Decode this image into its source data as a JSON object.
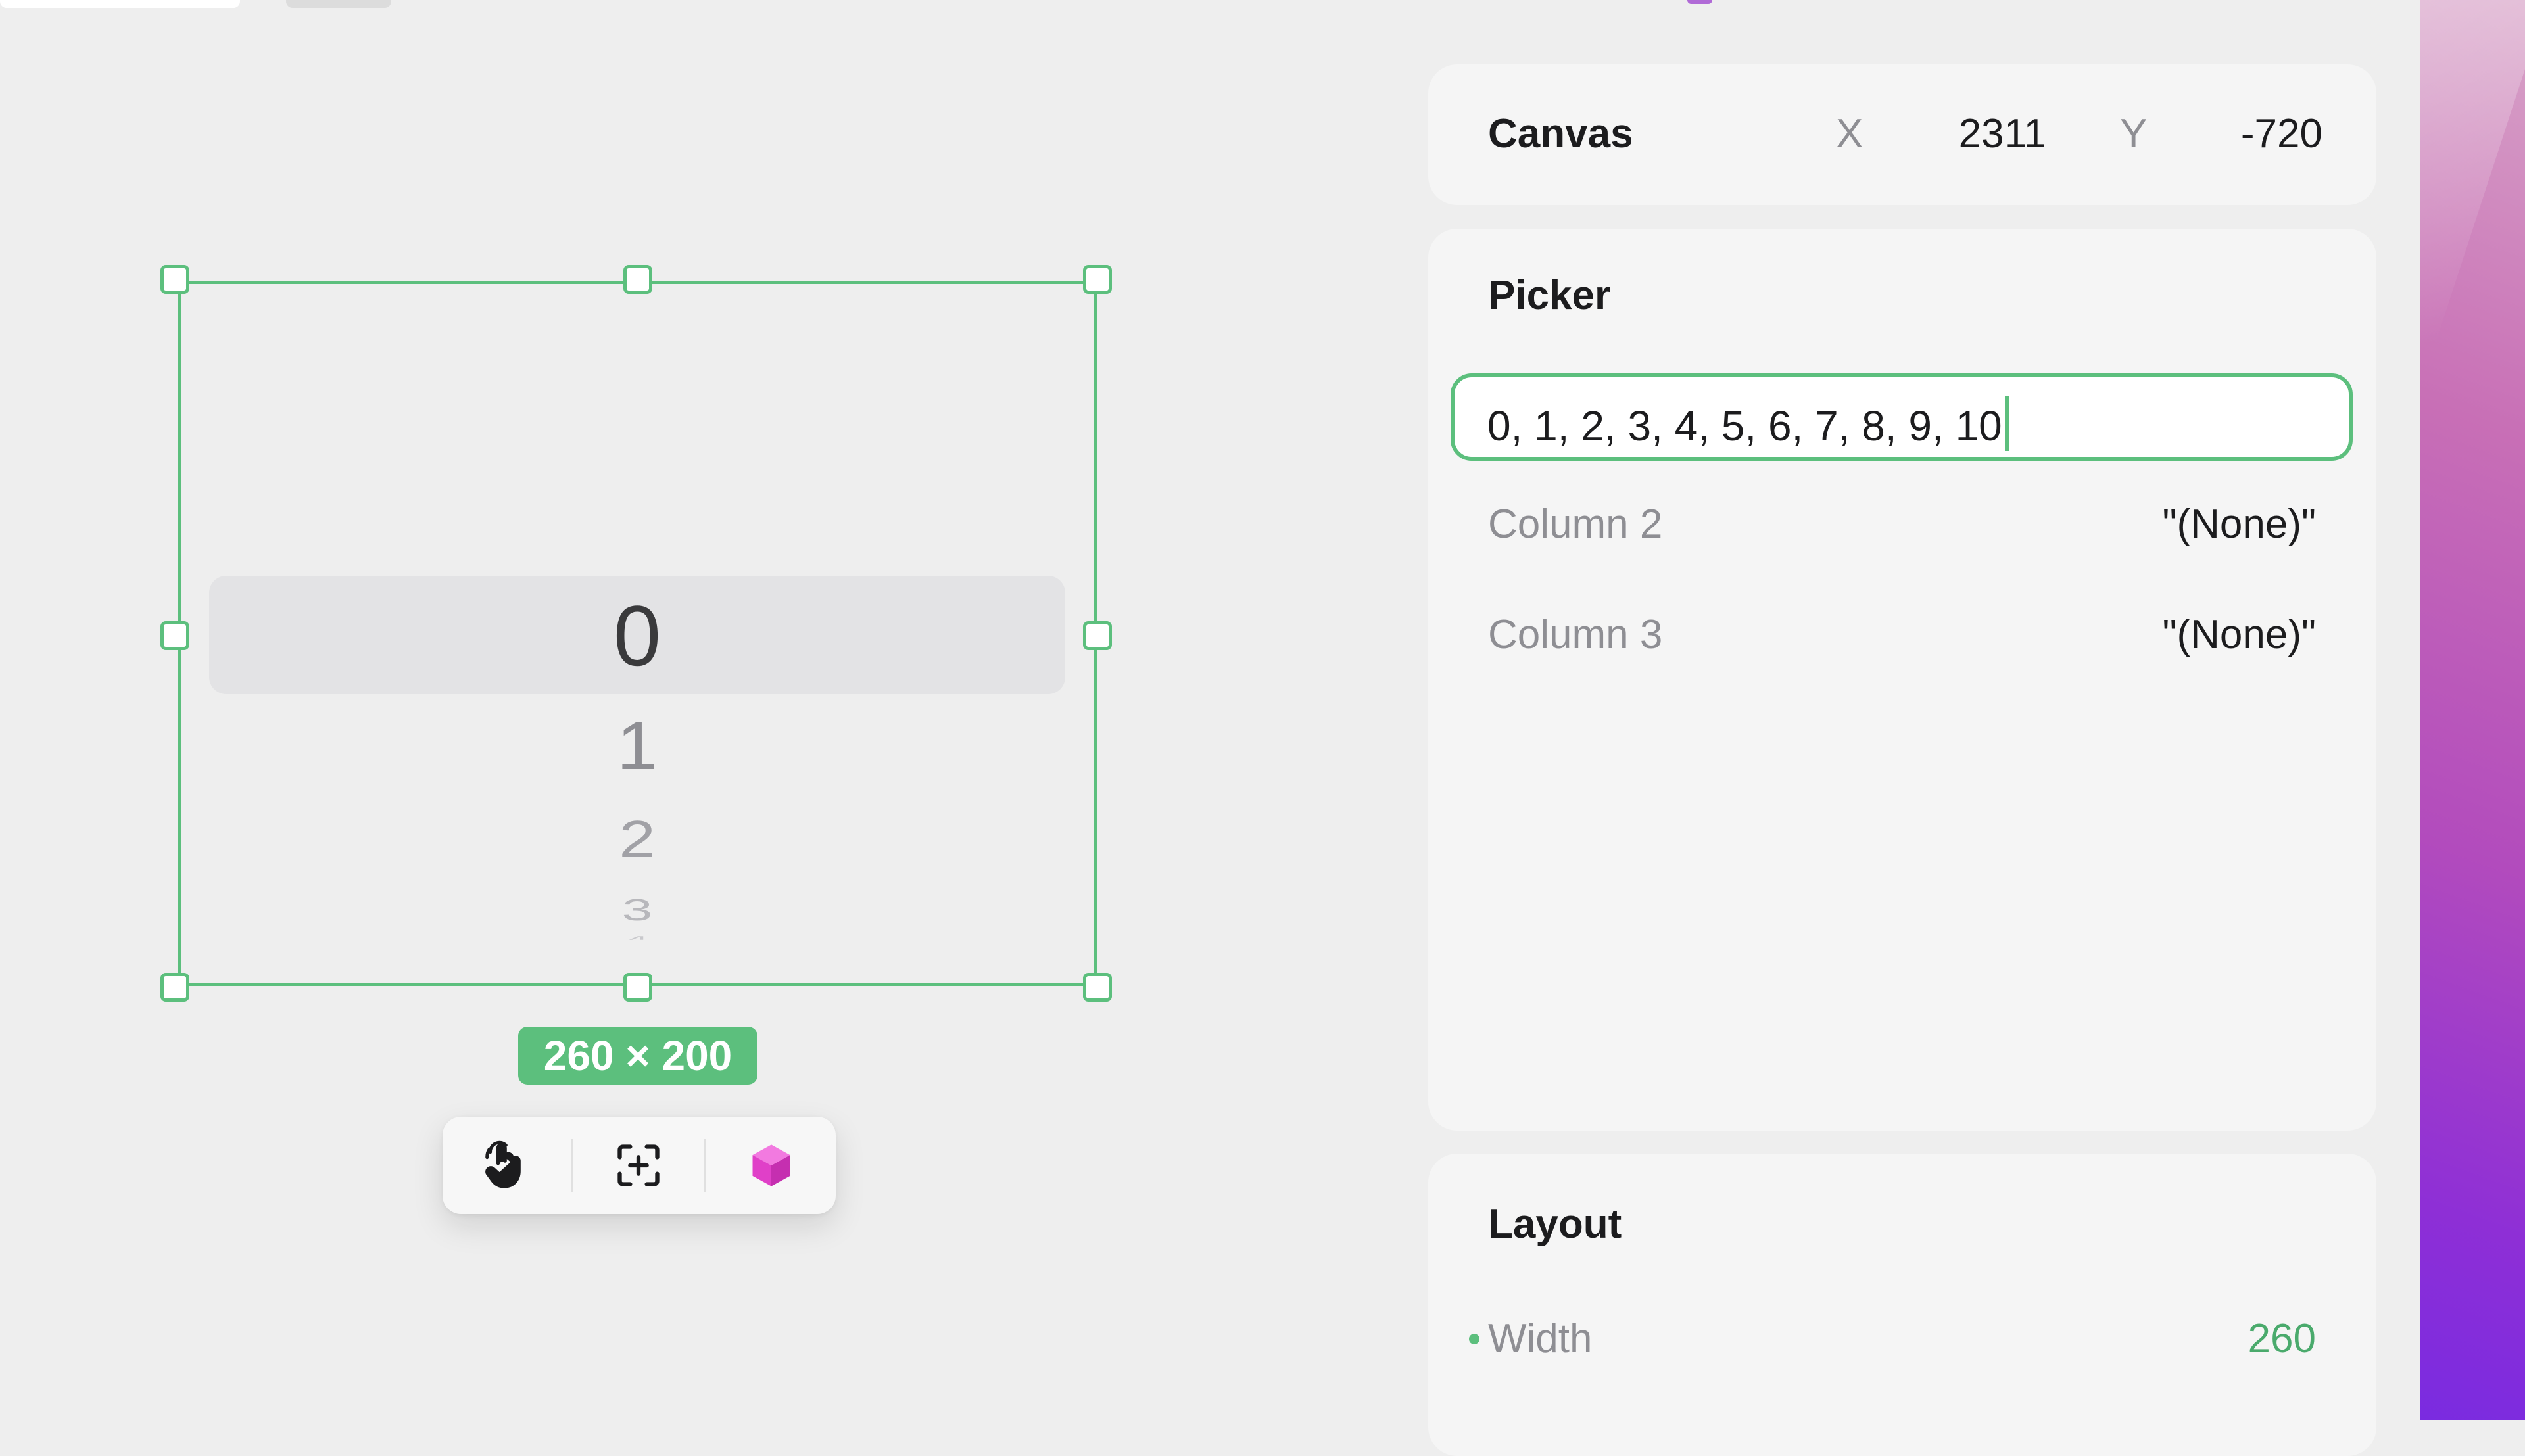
{
  "canvas_header": {
    "title": "Canvas",
    "x_label": "X",
    "x_value": "2311",
    "y_label": "Y",
    "y_value": "-720"
  },
  "picker_panel": {
    "title": "Picker",
    "column1_value": "0, 1, 2, 3, 4, 5, 6, 7, 8, 9, 10",
    "rows": [
      {
        "label": "Column 2",
        "value": "\"(None)\""
      },
      {
        "label": "Column 3",
        "value": "\"(None)\""
      }
    ]
  },
  "layout_panel": {
    "title": "Layout",
    "width_label": "Width",
    "width_value": "260"
  },
  "canvas_selection": {
    "size_badge": "260 × 200",
    "wheel_items": [
      "0",
      "1",
      "2",
      "3",
      "4"
    ]
  },
  "toolbar": {
    "items": [
      {
        "icon": "hand-pointer-icon"
      },
      {
        "icon": "focus-add-icon"
      },
      {
        "icon": "cube-icon"
      }
    ]
  },
  "colors": {
    "accent": "#5cbf7d",
    "cube": "#e040c8",
    "background": "#eeeeee",
    "panel": "#f5f5f5"
  }
}
